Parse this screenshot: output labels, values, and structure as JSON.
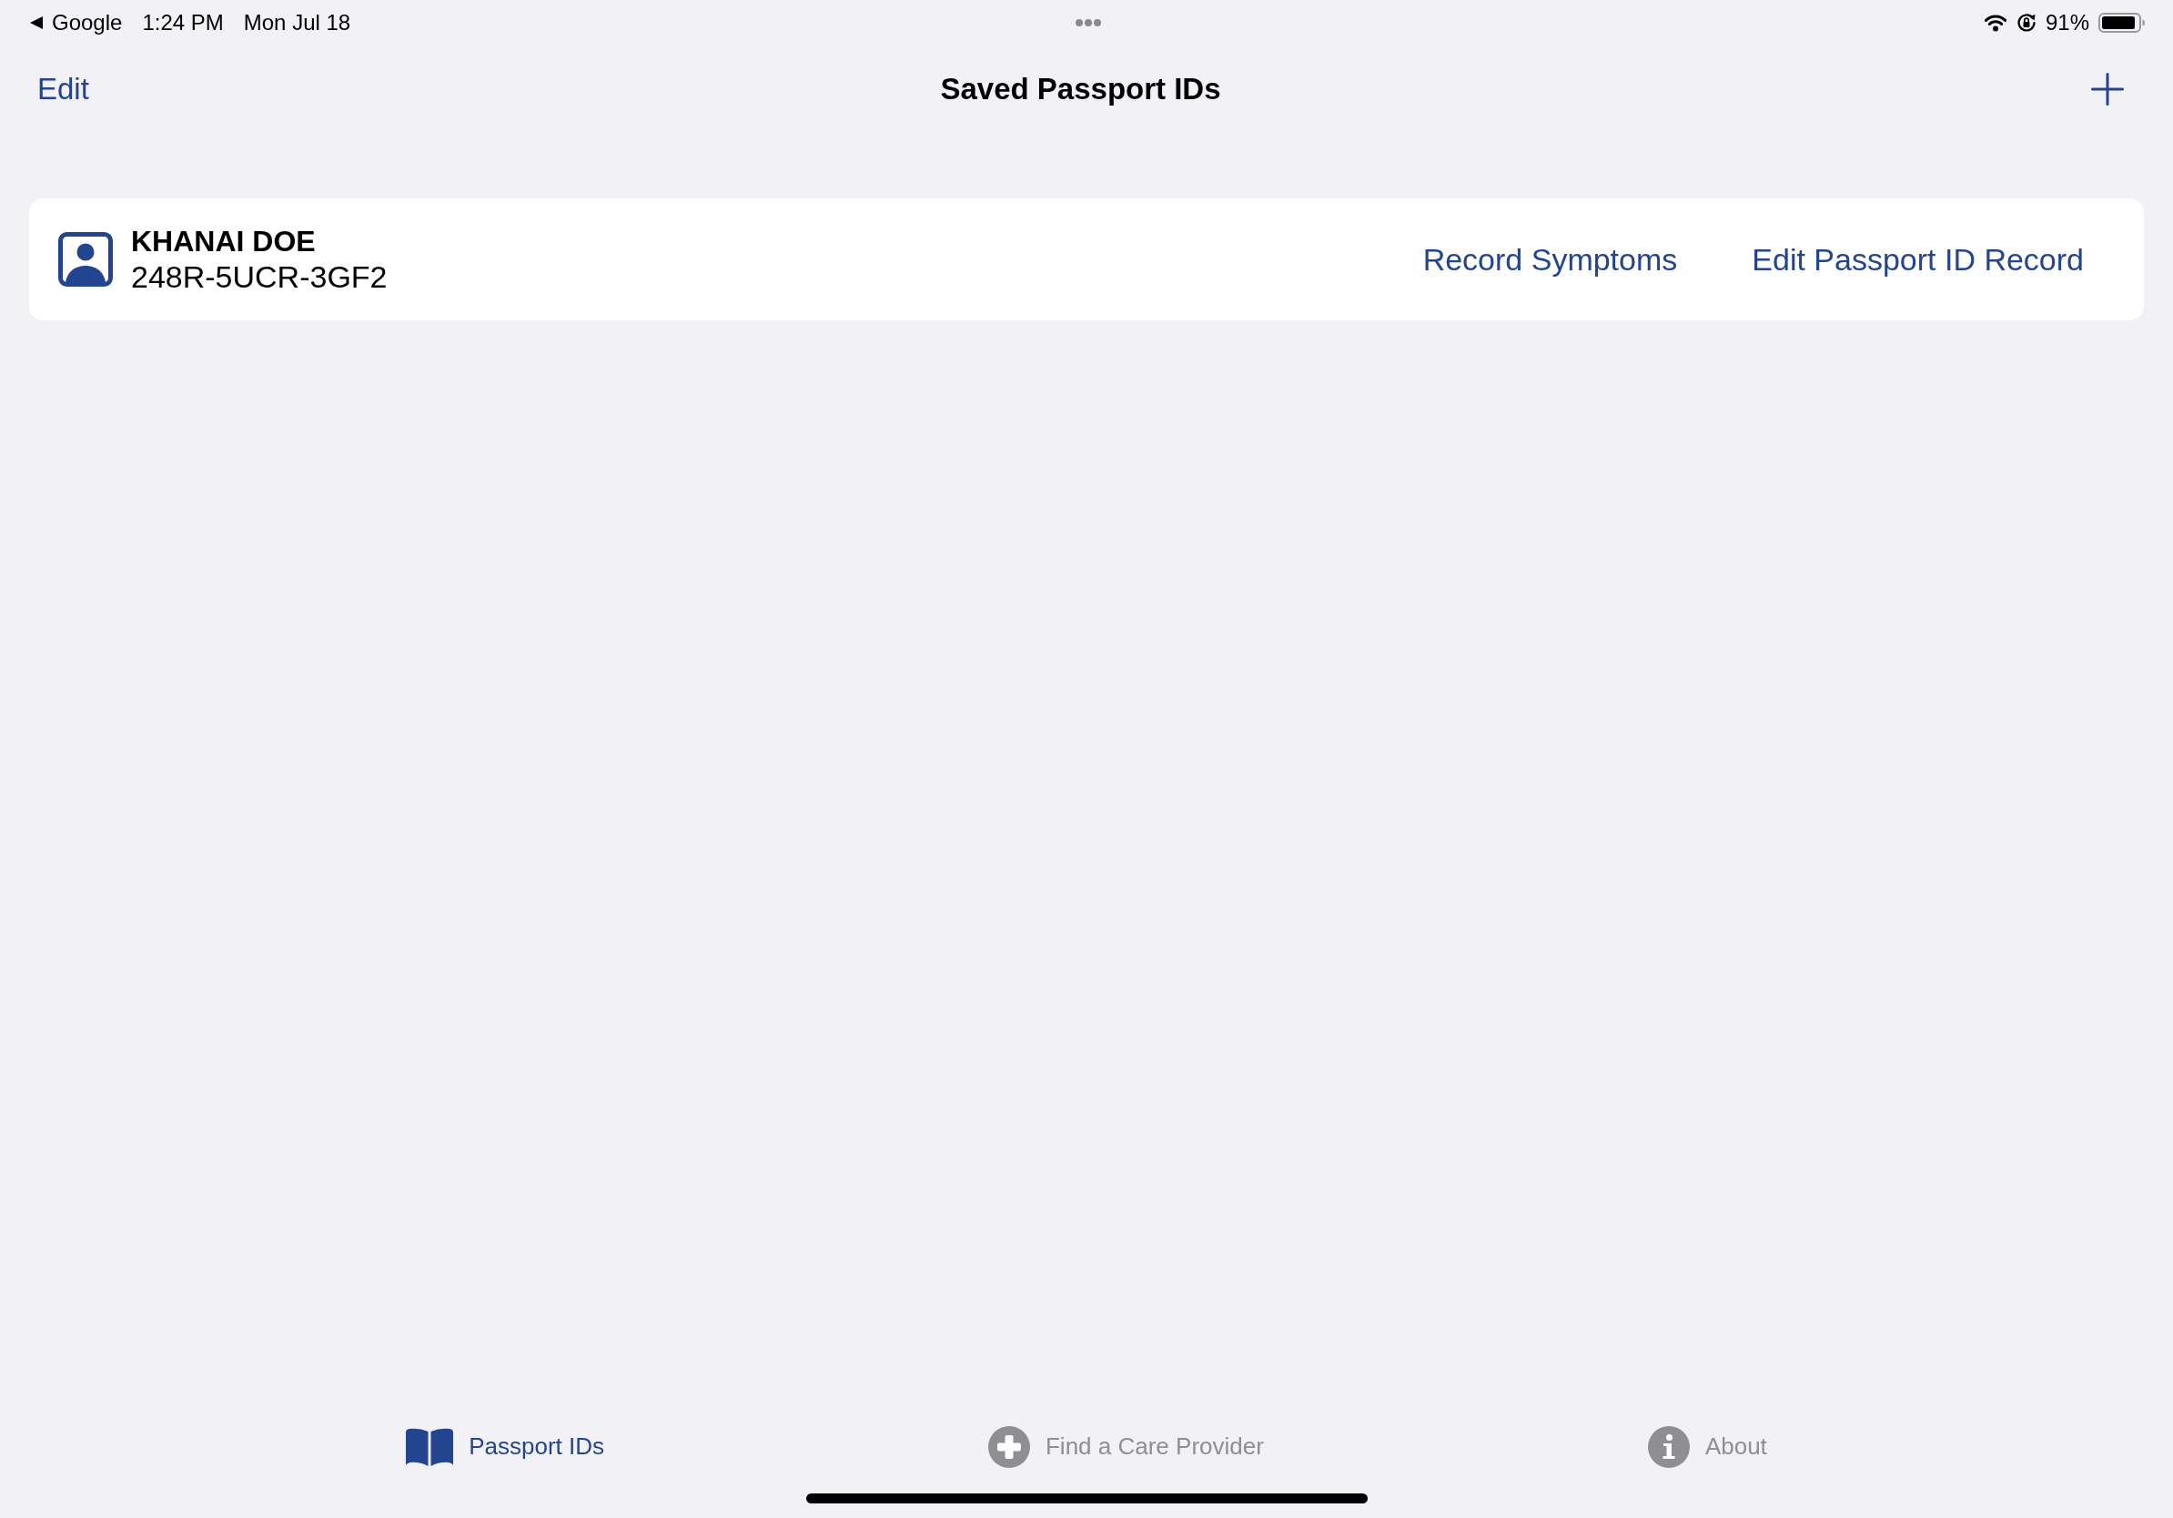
{
  "status_bar": {
    "back_app": "Google",
    "time": "1:24 PM",
    "date": "Mon Jul 18",
    "battery": "91%"
  },
  "nav_bar": {
    "left_button": "Edit",
    "title": "Saved Passport IDs"
  },
  "passports": [
    {
      "name": "KHANAI DOE",
      "passport_id": "248R-5UCR-3GF2",
      "actions": [
        "Record Symptoms",
        "Edit Passport ID Record"
      ]
    }
  ],
  "tab_bar": [
    {
      "label": "Passport IDs",
      "selected": true
    },
    {
      "label": "Find a Care Provider",
      "selected": false
    },
    {
      "label": "About",
      "selected": false
    }
  ]
}
